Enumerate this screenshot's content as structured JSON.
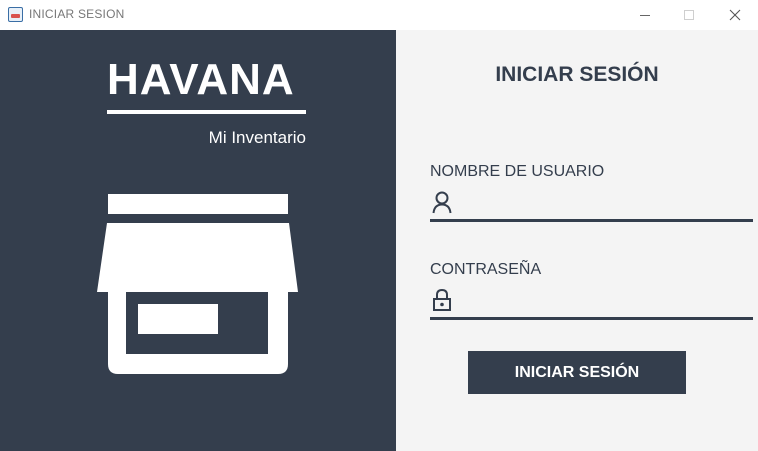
{
  "window": {
    "title": "INICIAR SESION",
    "controls": {
      "minimize_icon": "minimize-icon",
      "maximize_icon": "maximize-icon",
      "close_glyph": "✕"
    }
  },
  "brand": {
    "name": "HAVANA",
    "subtitle": "Mi Inventario",
    "icon": "inventory-box-icon"
  },
  "login": {
    "heading": "INICIAR SESIÓN",
    "username": {
      "label": "NOMBRE DE USUARIO",
      "value": "",
      "placeholder": "",
      "icon": "user-icon"
    },
    "password": {
      "label": "CONTRASEÑA",
      "value": "",
      "placeholder": "",
      "icon": "lock-icon"
    },
    "submit_label": "INICIAR SESIÓN"
  },
  "colors": {
    "primary": "#343e4d",
    "panel_light": "#f4f4f4",
    "text_light": "#ffffff"
  }
}
